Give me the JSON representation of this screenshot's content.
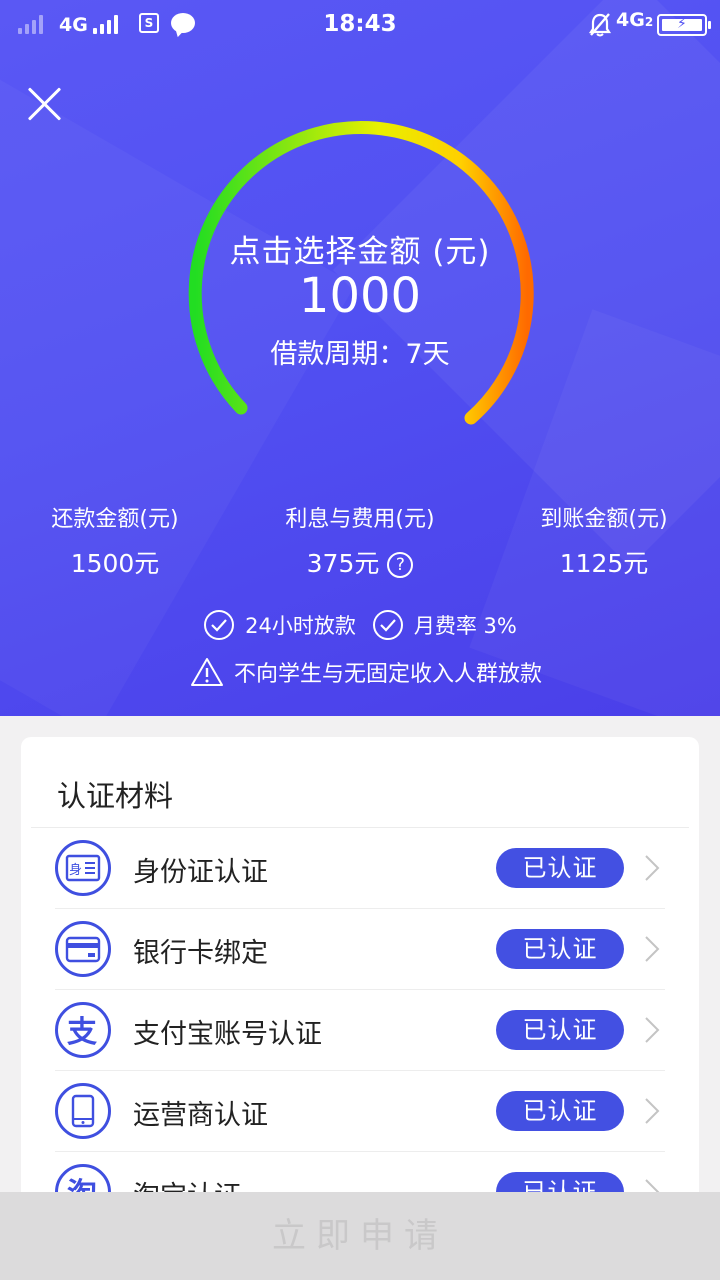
{
  "status_bar": {
    "net_left": "4G",
    "sim_label": "S",
    "time": "18:43",
    "net_right": "4G",
    "net_right_sub": "2",
    "icons": [
      "signal-icon",
      "sim-icon",
      "chat-bubble-icon",
      "mute-bell-icon",
      "battery-charging-icon"
    ]
  },
  "loan": {
    "title": "点击选择金额 (元)",
    "amount": "1000",
    "period": "借款周期：7天",
    "stats": [
      {
        "label": "还款金额(元)",
        "value": "1500元"
      },
      {
        "label": "利息与费用(元)",
        "value": "375元",
        "help": "?"
      },
      {
        "label": "到账金额(元)",
        "value": "1125元"
      }
    ],
    "features": [
      "24小时放款",
      "月费率 3%"
    ],
    "warning": "不向学生与无固定收入人群放款",
    "colors": {
      "accent": "#4350e2",
      "gauge_start": "#22dd22",
      "gauge_mid": "#ffee00",
      "gauge_end": "#ff6a00"
    }
  },
  "auth": {
    "title": "认证材料",
    "items": [
      {
        "label": "身份证认证",
        "status": "已认证",
        "icon": "id-card-icon"
      },
      {
        "label": "银行卡绑定",
        "status": "已认证",
        "icon": "bank-card-icon"
      },
      {
        "label": "支付宝账号认证",
        "status": "已认证",
        "icon": "alipay-icon"
      },
      {
        "label": "运营商认证",
        "status": "已认证",
        "icon": "phone-icon"
      },
      {
        "label": "淘宝认证",
        "status": "已认证",
        "icon": "taobao-icon"
      }
    ]
  },
  "apply_button": "立即申请"
}
